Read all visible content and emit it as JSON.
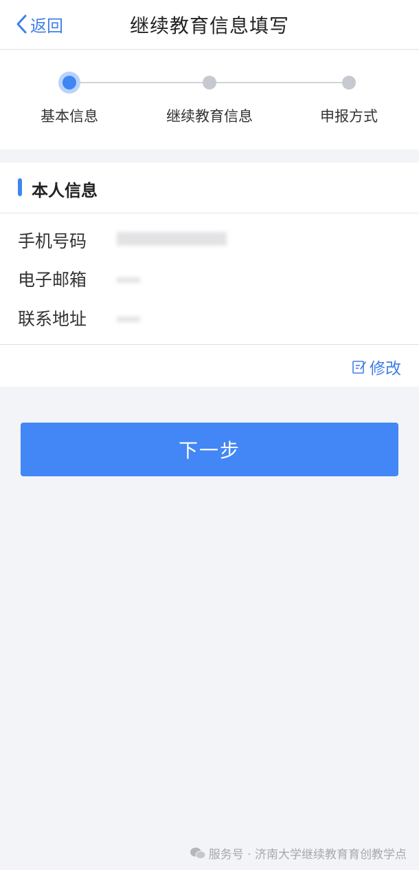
{
  "header": {
    "back_label": "返回",
    "title": "继续教育信息填写"
  },
  "steps": {
    "current": 1,
    "items": [
      {
        "label": "基本信息"
      },
      {
        "label": "继续教育信息"
      },
      {
        "label": "申报方式"
      }
    ]
  },
  "personal": {
    "section_title": "本人信息",
    "fields": [
      {
        "label": "手机号码",
        "value_icon": "blurred-redacted-value"
      },
      {
        "label": "电子邮箱",
        "value_icon": "blurred-redacted-value"
      },
      {
        "label": "联系地址",
        "value_icon": "blurred-redacted-value"
      }
    ],
    "edit_label": "修改"
  },
  "actions": {
    "next_label": "下一步"
  },
  "watermark": {
    "text": "服务号 · 济南大学继续教育育创教学点"
  },
  "colors": {
    "accent": "#3f86f2",
    "button": "#4287f5",
    "background": "#f3f4f8"
  }
}
